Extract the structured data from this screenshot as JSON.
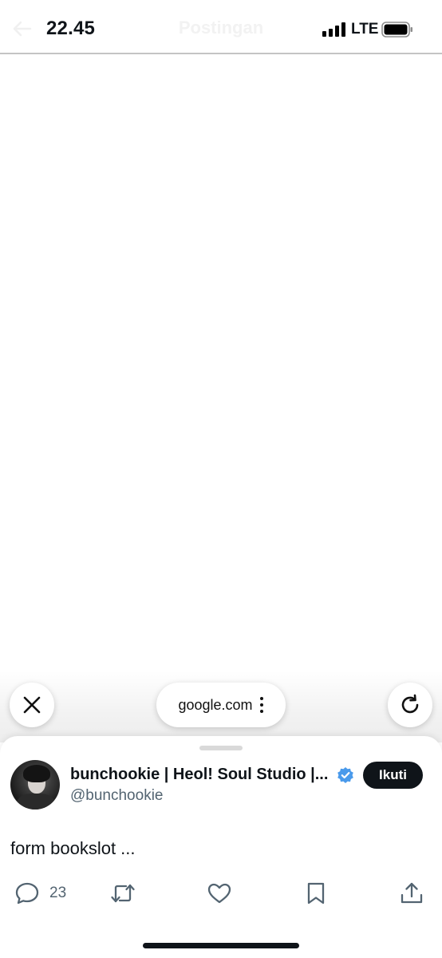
{
  "status_bar": {
    "time": "22.45",
    "network": "LTE",
    "header_title": "Postingan"
  },
  "browser": {
    "url": "google.com"
  },
  "post": {
    "display_name": "bunchookie | Heol! Soul Studio |...",
    "handle": "@bunchookie",
    "follow_label": "Ikuti",
    "text": "form bookslot ...",
    "reply_count": "23",
    "verified": true
  },
  "colors": {
    "verified_badge": "#4a9aeb",
    "follow_button": "#0f1419",
    "secondary_text": "#536471"
  }
}
